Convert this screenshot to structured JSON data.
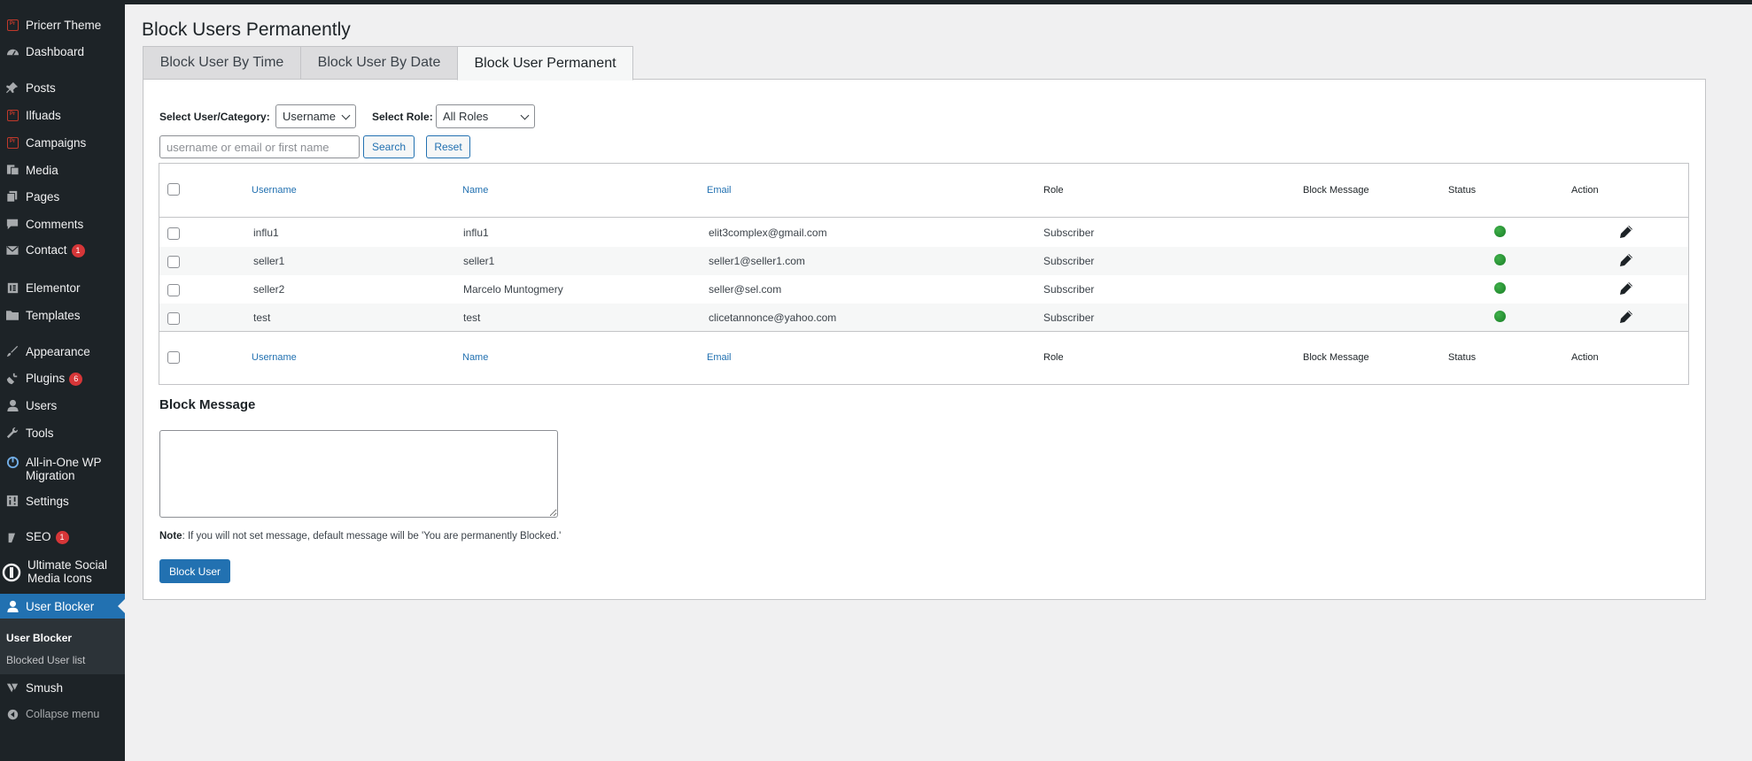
{
  "sidebar": {
    "items": [
      {
        "label": "Pricerr Theme",
        "icon": "pricerr-icon"
      },
      {
        "label": "Dashboard",
        "icon": "dashboard-icon"
      },
      {
        "label": "Posts",
        "icon": "pin-icon"
      },
      {
        "label": "Ilfuads",
        "icon": "pricerr-icon"
      },
      {
        "label": "Campaigns",
        "icon": "pricerr-icon"
      },
      {
        "label": "Media",
        "icon": "media-icon"
      },
      {
        "label": "Pages",
        "icon": "pages-icon"
      },
      {
        "label": "Comments",
        "icon": "comment-icon"
      },
      {
        "label": "Contact",
        "icon": "mail-icon",
        "badge": "1"
      },
      {
        "label": "Elementor",
        "icon": "elementor-icon"
      },
      {
        "label": "Templates",
        "icon": "folder-icon"
      },
      {
        "label": "Appearance",
        "icon": "brush-icon"
      },
      {
        "label": "Plugins",
        "icon": "plug-icon",
        "badge": "6"
      },
      {
        "label": "Users",
        "icon": "user-icon"
      },
      {
        "label": "Tools",
        "icon": "wrench-icon"
      },
      {
        "label_line1": "All-in-One WP",
        "label_line2": "Migration",
        "icon": "migration-icon"
      },
      {
        "label": "Settings",
        "icon": "settings-icon"
      },
      {
        "label": "SEO",
        "icon": "yoast-icon",
        "badge": "1"
      },
      {
        "label_line1": "Ultimate Social",
        "label_line2": "Media Icons",
        "icon": "social-icon"
      },
      {
        "label": "User Blocker",
        "icon": "user-icon",
        "active": true
      },
      {
        "label": "Smush",
        "icon": "smush-icon"
      }
    ],
    "submenu": {
      "current": "User Blocker",
      "other": "Blocked User list"
    },
    "collapse_label": "Collapse menu"
  },
  "page": {
    "title": "Block Users Permanently",
    "tabs": [
      "Block User By Time",
      "Block User By Date",
      "Block User Permanent"
    ],
    "active_tab": "Block User Permanent"
  },
  "filters": {
    "category_label": "Select User/Category:",
    "category_value": "Username",
    "role_label": "Select Role:",
    "role_value": "All Roles",
    "search_placeholder": "username or email or first name",
    "search_button": "Search",
    "reset_button": "Reset"
  },
  "table": {
    "columns": [
      "Username",
      "Name",
      "Email",
      "Role",
      "Block Message",
      "Status",
      "Action"
    ],
    "rows": [
      {
        "username": "influ1",
        "name": "influ1",
        "email": "elit3complex@gmail.com",
        "role": "Subscriber",
        "block_message": "",
        "status": "active"
      },
      {
        "username": "seller1",
        "name": "seller1",
        "email": "seller1@seller1.com",
        "role": "Subscriber",
        "block_message": "",
        "status": "active"
      },
      {
        "username": "seller2",
        "name": "Marcelo Muntogmery",
        "email": "seller@sel.com",
        "role": "Subscriber",
        "block_message": "",
        "status": "active"
      },
      {
        "username": "test",
        "name": "test",
        "email": "clicetannonce@yahoo.com",
        "role": "Subscriber",
        "block_message": "",
        "status": "active"
      }
    ]
  },
  "block_message": {
    "heading": "Block Message",
    "value": "",
    "note_label": "Note",
    "note_text": ": If you will not set message, default message will be 'You are permanently Blocked.'",
    "submit_button": "Block User"
  },
  "colors": {
    "accent": "#2271b1",
    "sidebar_bg": "#1d2327",
    "status_active": "#1e8a2a",
    "badge": "#d63638"
  }
}
